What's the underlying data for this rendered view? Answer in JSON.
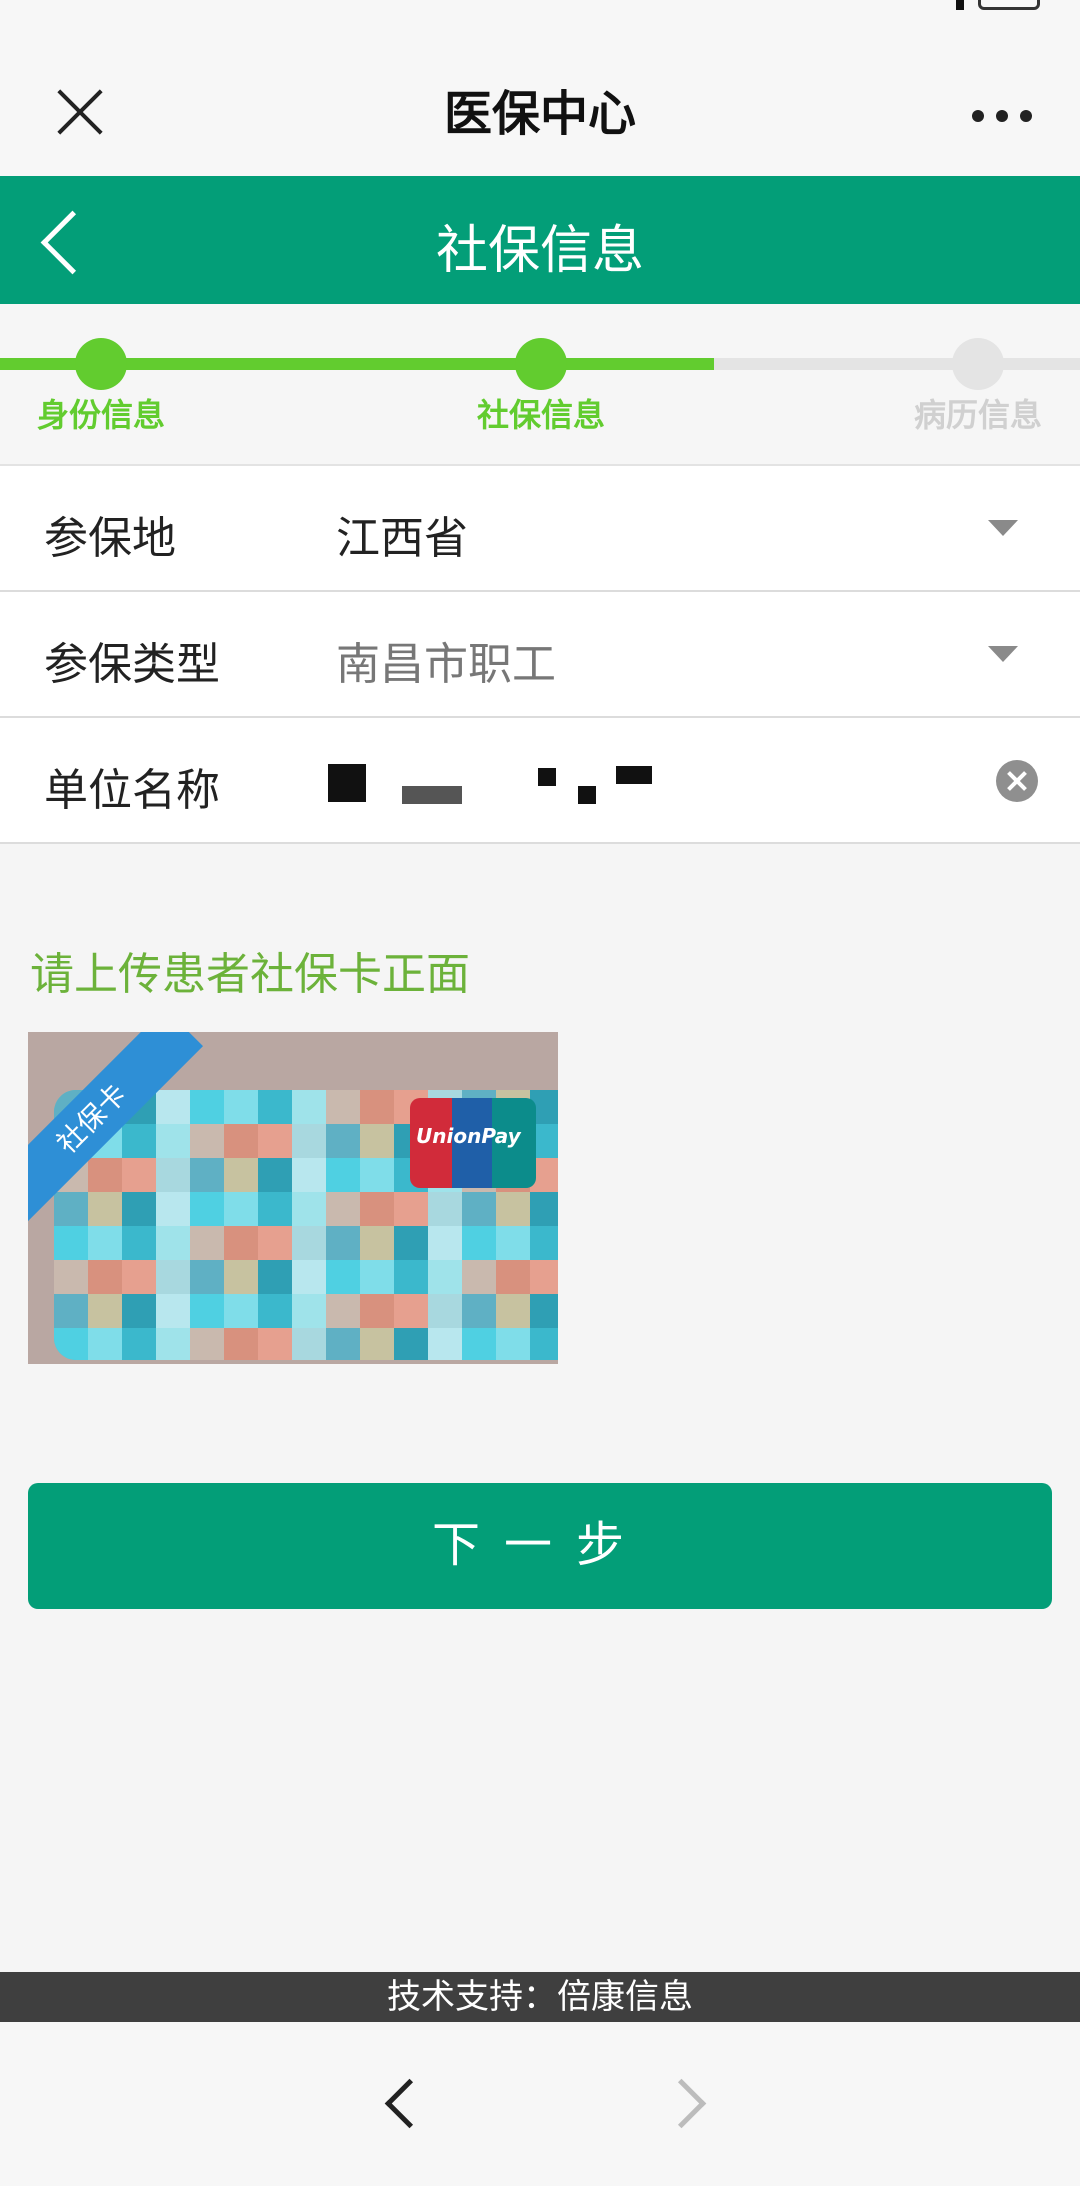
{
  "wechat": {
    "title": "医保中心"
  },
  "header": {
    "title": "社保信息"
  },
  "steps": [
    {
      "label": "身份信息",
      "state": "done",
      "color": "#62cc2f"
    },
    {
      "label": "社保信息",
      "state": "current",
      "color": "#62cc2f"
    },
    {
      "label": "病历信息",
      "state": "todo",
      "color": "#cfcfcf"
    }
  ],
  "form": {
    "insured_place": {
      "label": "参保地",
      "value": "江西省"
    },
    "insurance_type": {
      "label": "参保类型",
      "value": "南昌市职工"
    },
    "employer": {
      "label": "单位名称"
    }
  },
  "upload": {
    "title": "请上传患者社保卡正面",
    "ribbon": "社保卡",
    "brand": "UnionPay"
  },
  "actions": {
    "next": "下一步"
  },
  "footer": {
    "support": "技术支持：倍康信息"
  },
  "colors": {
    "brand_green": "#039e78",
    "step_green": "#62cc2f",
    "upload_title": "#6cb23a"
  }
}
